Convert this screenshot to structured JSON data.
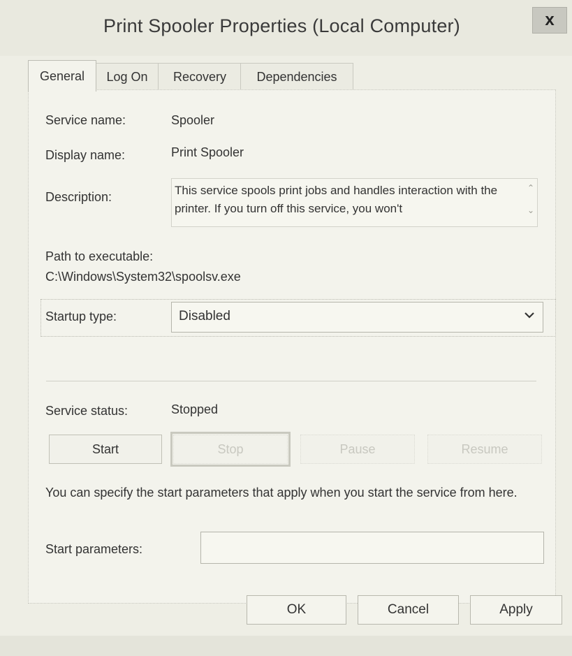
{
  "window": {
    "title": "Print Spooler Properties (Local Computer)",
    "close_label": "x"
  },
  "tabs": [
    {
      "label": "General",
      "active": true
    },
    {
      "label": "Log On",
      "active": false
    },
    {
      "label": "Recovery",
      "active": false
    },
    {
      "label": "Dependencies",
      "active": false
    }
  ],
  "general": {
    "service_name_label": "Service name:",
    "service_name_value": "Spooler",
    "display_name_label": "Display name:",
    "display_name_value": "Print Spooler",
    "description_label": "Description:",
    "description_value": "This service spools print jobs and handles interaction with the printer.  If you turn off this service, you won't",
    "path_label": "Path to executable:",
    "path_value": "C:\\Windows\\System32\\spoolsv.exe",
    "startup_type_label": "Startup type:",
    "startup_type_value": "Disabled",
    "service_status_label": "Service status:",
    "service_status_value": "Stopped",
    "buttons": {
      "start": "Start",
      "stop": "Stop",
      "pause": "Pause",
      "resume": "Resume"
    },
    "hint_text": "You can specify the start parameters that apply when you start the service from here.",
    "start_params_label": "Start parameters:",
    "start_params_value": ""
  },
  "footer": {
    "ok": "OK",
    "cancel": "Cancel",
    "apply": "Apply"
  },
  "icons": {
    "close": "close-icon",
    "dropdown": "chevron-down-icon",
    "scroll_up": "chevron-up-icon",
    "scroll_down": "chevron-down-icon"
  }
}
